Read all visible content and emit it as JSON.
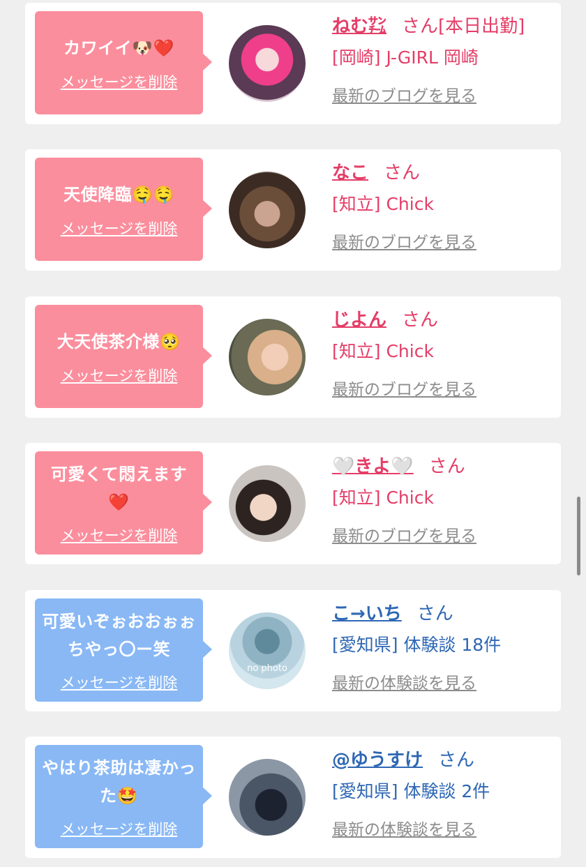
{
  "delete_label": "メッセージを削除",
  "cards": [
    {
      "message": "カワイイ🐶❤️",
      "name": "ねむ㌠",
      "name_suffix": "さん[本日出勤]",
      "location": "[岡崎] J-GIRL 岡崎",
      "latest_link": "最新のブログを見る",
      "theme": "pink"
    },
    {
      "message": "天使降臨🤤🤤",
      "name": "なこ",
      "name_suffix": "さん",
      "location": "[知立] Chick",
      "latest_link": "最新のブログを見る",
      "theme": "pink"
    },
    {
      "message": "大天使茶介様🥺",
      "name": "じよん",
      "name_suffix": "さん",
      "location": "[知立] Chick",
      "latest_link": "最新のブログを見る",
      "theme": "pink"
    },
    {
      "message": "可愛くて悶えます❤️",
      "name": "🤍きよ🤍",
      "name_suffix": "さん",
      "location": "[知立] Chick",
      "latest_link": "最新のブログを見る",
      "theme": "pink"
    },
    {
      "message": "可愛いぞぉおおぉぉちやっ〇ー笑",
      "name": "こ→いち",
      "name_suffix": "さん",
      "location": "[愛知県] 体験談 18件",
      "latest_link": "最新の体験談を見る",
      "theme": "blue",
      "avatar_text": "no photo"
    },
    {
      "message": "やはり茶助は凄かった🤩",
      "name": "@ゆうすけ",
      "name_suffix": "さん",
      "location": "[愛知県] 体験談 2件",
      "latest_link": "最新の体験談を見る",
      "theme": "blue"
    }
  ],
  "colors": {
    "pink_bubble": "#fb8e9d",
    "blue_bubble": "#89b8f5",
    "pink_text": "#e43d67",
    "blue_text": "#2e67b4"
  }
}
